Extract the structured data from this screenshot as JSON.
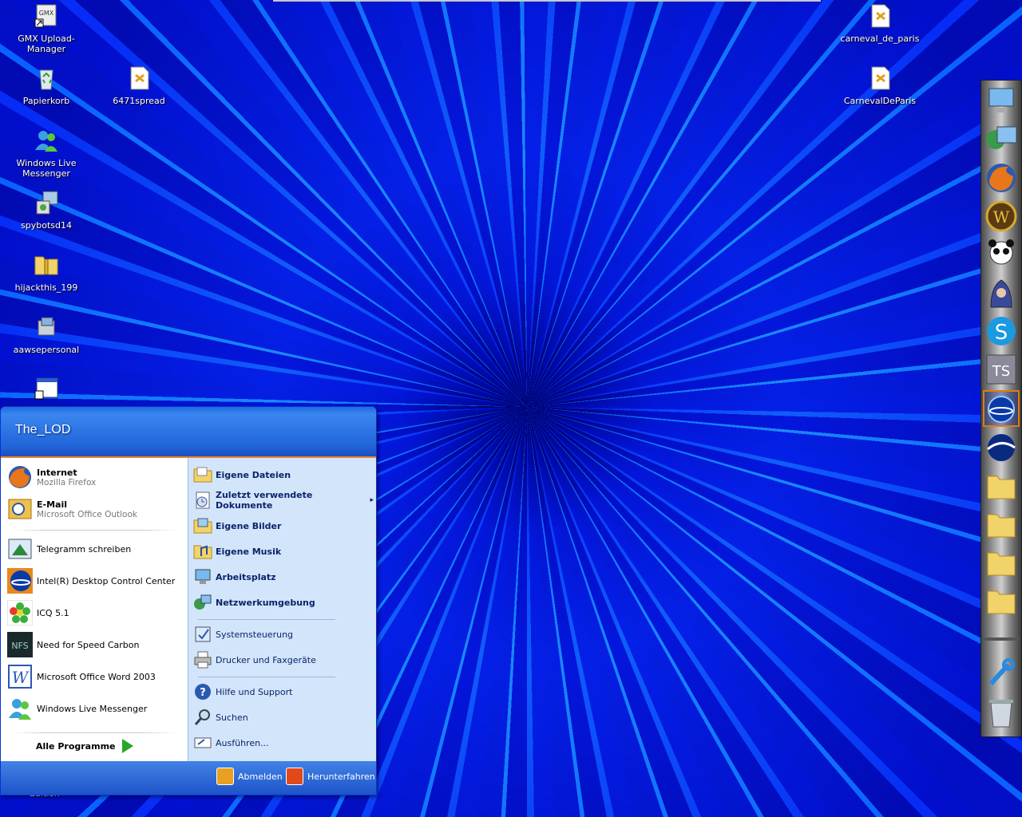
{
  "desktop": {
    "icons": [
      {
        "label": "GMX Upload-Manager",
        "icon": "gmx-upload-icon"
      },
      {
        "label": "Papierkorb",
        "icon": "recycle-bin-icon"
      },
      {
        "label": "6471spread",
        "icon": "document-icon"
      },
      {
        "label": "Windows Live Messenger",
        "icon": "messenger-icon"
      },
      {
        "label": "spybotsd14",
        "icon": "installer-icon"
      },
      {
        "label": "hijackthis_199",
        "icon": "zip-folder-icon"
      },
      {
        "label": "aawsepersonal",
        "icon": "installer-icon"
      },
      {
        "label": "carneval_de_paris",
        "icon": "document-icon"
      },
      {
        "label": "CarnevalDeParis",
        "icon": "document-icon"
      }
    ],
    "behind_label": "Edition"
  },
  "start_menu": {
    "user": "The_LOD",
    "pinned": [
      {
        "title": "Internet",
        "subtitle": "Mozilla Firefox"
      },
      {
        "title": "E-Mail",
        "subtitle": "Microsoft Office Outlook"
      }
    ],
    "recent": [
      "Telegramm schreiben",
      "Intel(R) Desktop Control Center",
      "ICQ 5.1",
      "Need for Speed Carbon",
      "Microsoft Office Word 2003",
      "Windows Live Messenger"
    ],
    "all_programs": "Alle Programme",
    "places": [
      "Eigene Dateien",
      "Zuletzt verwendete Dokumente",
      "Eigene Bilder",
      "Eigene Musik",
      "Arbeitsplatz",
      "Netzwerkumgebung"
    ],
    "settings": [
      "Systemsteuerung",
      "Drucker und Faxgeräte"
    ],
    "tools": [
      "Hilfe und Support",
      "Suchen",
      "Ausführen..."
    ],
    "logoff": "Abmelden",
    "shutdown": "Herunterfahren"
  },
  "colors": {
    "menu_blue": "#2164d8",
    "orange_accent": "#e9872a",
    "places_bg": "#d3e5fa"
  }
}
